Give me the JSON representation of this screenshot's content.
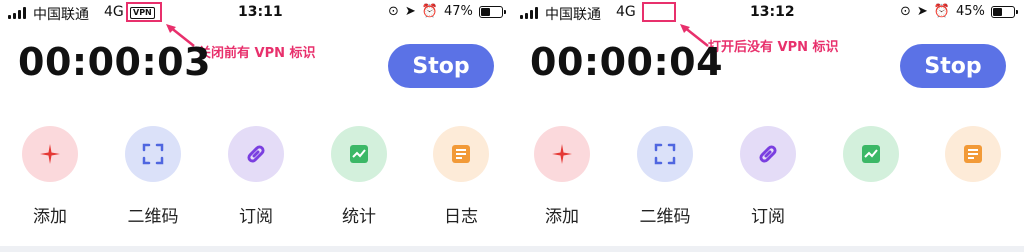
{
  "left": {
    "status": {
      "carrier": "中国联通",
      "network": "4G",
      "vpn": "VPN",
      "time": "13:11",
      "battery": "47%",
      "battery_level": 0.47
    },
    "annotation": "关闭前有 VPN 标识",
    "timer": "00:00:03",
    "stop_label": "Stop",
    "actions": [
      {
        "label": "添加",
        "icon": "plus-icon",
        "bg": "#fbd9dc",
        "fg": "#e53935"
      },
      {
        "label": "二维码",
        "icon": "qr-scan-icon",
        "bg": "#dbe1f9",
        "fg": "#4f66e0"
      },
      {
        "label": "订阅",
        "icon": "link-icon",
        "bg": "#e4dcf7",
        "fg": "#7a3fe0"
      },
      {
        "label": "统计",
        "icon": "chart-icon",
        "bg": "#d3f0dc",
        "fg": "#3cb867"
      },
      {
        "label": "日志",
        "icon": "log-icon",
        "bg": "#fdebd8",
        "fg": "#f29a38"
      }
    ]
  },
  "right": {
    "status": {
      "carrier": "中国联通",
      "network": "4G",
      "time": "13:12",
      "battery": "45%",
      "battery_level": 0.45
    },
    "annotation": "打开后没有 VPN 标识",
    "timer": "00:00:04",
    "stop_label": "Stop",
    "actions": [
      {
        "label": "添加",
        "icon": "plus-icon",
        "bg": "#fbd9dc",
        "fg": "#e53935"
      },
      {
        "label": "二维码",
        "icon": "qr-scan-icon",
        "bg": "#dbe1f9",
        "fg": "#4f66e0"
      },
      {
        "label": "订阅",
        "icon": "link-icon",
        "bg": "#e4dcf7",
        "fg": "#7a3fe0"
      },
      {
        "label": "",
        "icon": "chart-icon",
        "bg": "#d3f0dc",
        "fg": "#3cb867"
      },
      {
        "label": "",
        "icon": "log-icon",
        "bg": "#fdebd8",
        "fg": "#f29a38"
      }
    ]
  },
  "colors": {
    "annotation": "#e8306c",
    "stop_button": "#5b72e6"
  }
}
